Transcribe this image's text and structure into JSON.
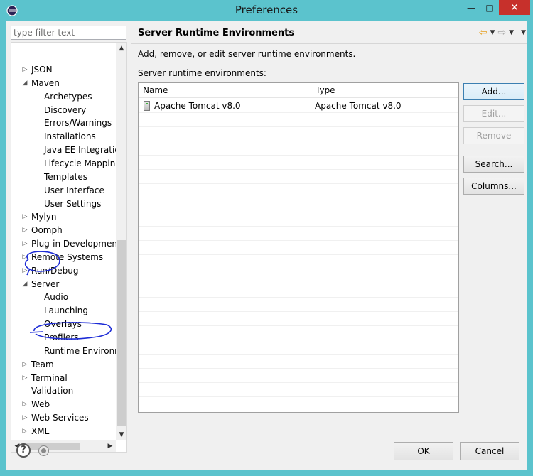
{
  "window": {
    "title": "Preferences",
    "controls": {
      "minimize": "—",
      "maximize": "□",
      "close": "✕"
    }
  },
  "filter": {
    "placeholder": "type filter text",
    "value": ""
  },
  "tree": {
    "items": [
      {
        "label": "JSON",
        "arrow": "▷",
        "level": 0
      },
      {
        "label": "Maven",
        "arrow": "◢",
        "level": 0
      },
      {
        "label": "Archetypes",
        "arrow": "",
        "level": 1
      },
      {
        "label": "Discovery",
        "arrow": "",
        "level": 1
      },
      {
        "label": "Errors/Warnings",
        "arrow": "",
        "level": 1
      },
      {
        "label": "Installations",
        "arrow": "",
        "level": 1
      },
      {
        "label": "Java EE Integratio",
        "arrow": "",
        "level": 1
      },
      {
        "label": "Lifecycle Mapping",
        "arrow": "",
        "level": 1
      },
      {
        "label": "Templates",
        "arrow": "",
        "level": 1
      },
      {
        "label": "User Interface",
        "arrow": "",
        "level": 1
      },
      {
        "label": "User Settings",
        "arrow": "",
        "level": 1
      },
      {
        "label": "Mylyn",
        "arrow": "▷",
        "level": 0
      },
      {
        "label": "Oomph",
        "arrow": "▷",
        "level": 0
      },
      {
        "label": "Plug-in Development",
        "arrow": "▷",
        "level": 0
      },
      {
        "label": "Remote Systems",
        "arrow": "▷",
        "level": 0
      },
      {
        "label": "Run/Debug",
        "arrow": "▷",
        "level": 0
      },
      {
        "label": "Server",
        "arrow": "◢",
        "level": 0
      },
      {
        "label": "Audio",
        "arrow": "",
        "level": 1
      },
      {
        "label": "Launching",
        "arrow": "",
        "level": 1
      },
      {
        "label": "Overlays",
        "arrow": "",
        "level": 1
      },
      {
        "label": "Profilers",
        "arrow": "",
        "level": 1
      },
      {
        "label": "Runtime Environm",
        "arrow": "",
        "level": 1,
        "selected": true
      },
      {
        "label": "Team",
        "arrow": "▷",
        "level": 0
      },
      {
        "label": "Terminal",
        "arrow": "▷",
        "level": 0
      },
      {
        "label": "Validation",
        "arrow": "",
        "level": 0
      },
      {
        "label": "Web",
        "arrow": "▷",
        "level": 0
      },
      {
        "label": "Web Services",
        "arrow": "▷",
        "level": 0
      },
      {
        "label": "XML",
        "arrow": "▷",
        "level": 0
      }
    ],
    "scroll": {
      "up": "▲",
      "down": "▼",
      "left": "◀",
      "right": "▶"
    }
  },
  "page": {
    "title": "Server Runtime Environments",
    "description": "Add, remove, or edit server runtime environments.",
    "table_label": "Server runtime environments:",
    "nav": {
      "back": "⇦",
      "back_drop": "▼",
      "forward": "⇨",
      "forward_drop": "▼",
      "menu": "▼"
    },
    "table": {
      "columns": [
        "Name",
        "Type"
      ],
      "rows": [
        {
          "name": "Apache Tomcat v8.0",
          "type": "Apache Tomcat v8.0"
        }
      ]
    },
    "buttons": {
      "add": "Add...",
      "edit": "Edit...",
      "remove": "Remove",
      "search": "Search...",
      "columns": "Columns..."
    }
  },
  "footer": {
    "help": "?",
    "ok": "OK",
    "cancel": "Cancel"
  },
  "colors": {
    "titlebar": "#5bc3cd",
    "close": "#c7302b",
    "annotation": "#1c2bd6"
  }
}
